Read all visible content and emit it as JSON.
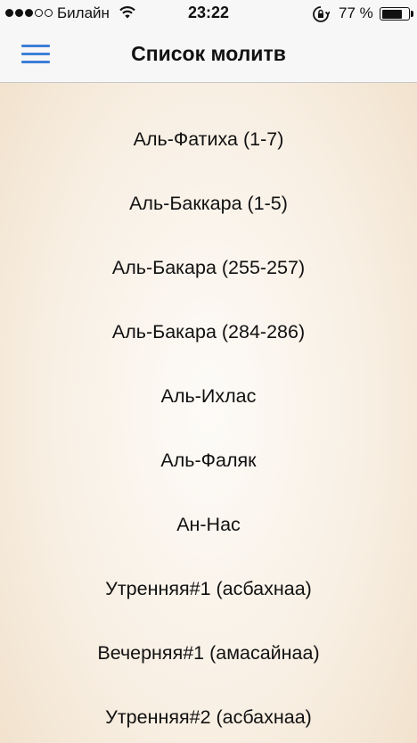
{
  "status_bar": {
    "signal_bars": [
      true,
      true,
      true,
      false,
      false
    ],
    "carrier": "Билайн",
    "time": "23:22",
    "battery_percent": "77 %",
    "battery_level": 0.77,
    "icons": [
      "signal-dots-icon",
      "wifi-icon",
      "rotation-lock-icon",
      "battery-icon"
    ]
  },
  "nav": {
    "title": "Список молитв",
    "menu_icon": "hamburger-menu-icon",
    "accent_color": "#3d7fd6"
  },
  "prayers": [
    "Аль-Фатиха (1-7)",
    "Аль-Баккара (1-5)",
    "Аль-Бакара (255-257)",
    "Аль-Бакара (284-286)",
    "Аль-Ихлас",
    "Аль-Фаляк",
    "Ан-Нас",
    "Утренняя#1 (асбахнаа)",
    "Вечерняя#1 (амасайнаа)",
    "Утренняя#2 (асбахнаа)"
  ]
}
